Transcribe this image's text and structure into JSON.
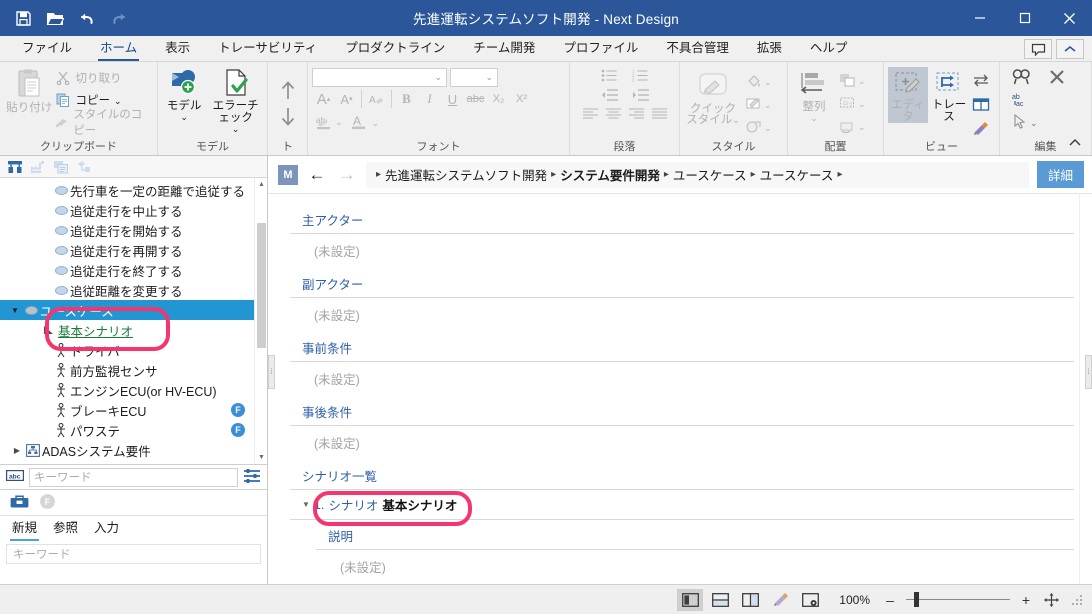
{
  "window": {
    "title": "先進運転システムソフト開発 - Next Design",
    "minimize": "–",
    "maximize": "□",
    "close": "✕"
  },
  "quick_access": [
    {
      "name": "save-icon",
      "label": "保存"
    },
    {
      "name": "open-icon",
      "label": "開く"
    },
    {
      "name": "undo-icon",
      "label": "元に戻す"
    },
    {
      "name": "redo-icon",
      "label": "やり直し"
    }
  ],
  "ribbon": {
    "tabs": [
      {
        "label": "ファイル",
        "active": false
      },
      {
        "label": "ホーム",
        "active": true
      },
      {
        "label": "表示",
        "active": false
      },
      {
        "label": "トレーサビリティ",
        "active": false
      },
      {
        "label": "プロダクトライン",
        "active": false
      },
      {
        "label": "チーム開発",
        "active": false
      },
      {
        "label": "プロファイル",
        "active": false
      },
      {
        "label": "不具合管理",
        "active": false
      },
      {
        "label": "拡張",
        "active": false
      },
      {
        "label": "ヘルプ",
        "active": false
      }
    ],
    "groups": {
      "clipboard": {
        "label": "クリップボード",
        "paste": "貼り付け",
        "cut": "切り取り",
        "copy": "コピー",
        "copy_style": "スタイルのコピー"
      },
      "model": {
        "label": "モデル",
        "model": "モデル",
        "error_check": "エラーチェック"
      },
      "trace": {
        "label": "トレ..."
      },
      "font": {
        "label": "フォント",
        "font_name": "",
        "font_size": "",
        "bold": "B",
        "italic": "I",
        "underline": "U",
        "strike": "abc",
        "subscript": "X₂",
        "superscript": "X²",
        "grow": "A",
        "shrink": "A"
      },
      "paragraph": {
        "label": "段落"
      },
      "style": {
        "label": "スタイル",
        "quick_style_1": "クイック",
        "quick_style_2": "スタイル"
      },
      "arrange": {
        "label": "配置",
        "align": "整列"
      },
      "view": {
        "label": "ビュー",
        "editor": "エディタ",
        "trace": "トレース"
      },
      "edit": {
        "label": "編集"
      }
    },
    "help_balloon": "フィードバック",
    "collapse": "^"
  },
  "sidebar": {
    "toolbar": [
      {
        "name": "model-navigator-icon"
      },
      {
        "name": "factory-icon"
      },
      {
        "name": "copy-tree-icon"
      },
      {
        "name": "link-tree-icon"
      }
    ],
    "tree": [
      {
        "label": "先行車を一定の距離で追従する",
        "icon": "usecase-oval-icon",
        "indent": 2,
        "selected": false,
        "twisty": "",
        "badge": ""
      },
      {
        "label": "追従走行を中止する",
        "icon": "usecase-oval-icon",
        "indent": 2,
        "selected": false,
        "twisty": "",
        "badge": ""
      },
      {
        "label": "追従走行を開始する",
        "icon": "usecase-oval-icon",
        "indent": 2,
        "selected": false,
        "twisty": "",
        "badge": ""
      },
      {
        "label": "追従走行を再開する",
        "icon": "usecase-oval-icon",
        "indent": 2,
        "selected": false,
        "twisty": "",
        "badge": ""
      },
      {
        "label": "追従走行を終了する",
        "icon": "usecase-oval-icon",
        "indent": 2,
        "selected": false,
        "twisty": "",
        "badge": ""
      },
      {
        "label": "追従距離を変更する",
        "icon": "usecase-oval-icon",
        "indent": 2,
        "selected": false,
        "twisty": "",
        "badge": ""
      },
      {
        "label": "ユースケース",
        "icon": "usecase-oval-icon",
        "indent": 2,
        "selected": true,
        "twisty": "▼",
        "badge": ""
      },
      {
        "label": "基本シナリオ",
        "icon": "scenario-icon",
        "indent": 3,
        "selected": false,
        "twisty": "",
        "badge": "",
        "link": true
      },
      {
        "label": "ドライバ",
        "icon": "actor-icon",
        "indent": 2,
        "selected": false,
        "twisty": "",
        "badge": ""
      },
      {
        "label": "前方監視センサ",
        "icon": "actor-icon",
        "indent": 2,
        "selected": false,
        "twisty": "",
        "badge": ""
      },
      {
        "label": "エンジンECU(or HV-ECU)",
        "icon": "actor-icon",
        "indent": 2,
        "selected": false,
        "twisty": "",
        "badge": ""
      },
      {
        "label": "ブレーキECU",
        "icon": "actor-icon",
        "indent": 2,
        "selected": false,
        "twisty": "",
        "badge": "F"
      },
      {
        "label": "パワステ",
        "icon": "actor-icon",
        "indent": 2,
        "selected": false,
        "twisty": "",
        "badge": "F"
      },
      {
        "label": "ADASシステム要件",
        "icon": "system-req-icon",
        "indent": 1,
        "selected": false,
        "twisty": "▶",
        "badge": ""
      }
    ],
    "keyword_placeholder": "キーワード",
    "bottom": {
      "tabs": [
        {
          "label": "新規",
          "active": true
        },
        {
          "label": "参照",
          "active": false
        },
        {
          "label": "入力",
          "active": false
        }
      ],
      "icons": [
        {
          "name": "toolbox-icon"
        },
        {
          "name": "f-badge-icon",
          "label": "F"
        }
      ],
      "keyword_placeholder": "キーワード"
    }
  },
  "editor": {
    "badge": "M",
    "back": "←",
    "forward": "→",
    "breadcrumb": [
      {
        "label": "先進運転システムソフト開発",
        "bold": false
      },
      {
        "label": "システム要件開発",
        "bold": true
      },
      {
        "label": "ユースケース",
        "bold": false
      },
      {
        "label": "ユースケース",
        "bold": false
      }
    ],
    "detail_button": "詳細",
    "fields": [
      {
        "label": "主アクター",
        "value": "(未設定)"
      },
      {
        "label": "副アクター",
        "value": "(未設定)"
      },
      {
        "label": "事前条件",
        "value": "(未設定)"
      },
      {
        "label": "事後条件",
        "value": "(未設定)"
      }
    ],
    "scenario_section": {
      "label": "シナリオ一覧",
      "twisty": "▼",
      "number": "1.",
      "type": "シナリオ",
      "name": "基本シナリオ",
      "sub_label": "説明",
      "sub_value": "(未設定)"
    }
  },
  "status": {
    "view_buttons": [
      {
        "name": "layout-single-icon",
        "active": true
      },
      {
        "name": "layout-horizontal-split-icon",
        "active": false
      },
      {
        "name": "layout-vertical-split-icon",
        "active": false
      },
      {
        "name": "paint-icon",
        "active": false
      },
      {
        "name": "settings-view-icon",
        "active": false
      }
    ],
    "zoom_level": "100%",
    "zoom_out": "–",
    "zoom_in": "+",
    "fit_icon": "fit-screen-icon"
  },
  "colors": {
    "title_bar": "#2b579a",
    "accent": "#2196d3",
    "highlight_box": "#f5366e",
    "link": "#2f5fa8",
    "detail_button": "#5b9bd5"
  }
}
